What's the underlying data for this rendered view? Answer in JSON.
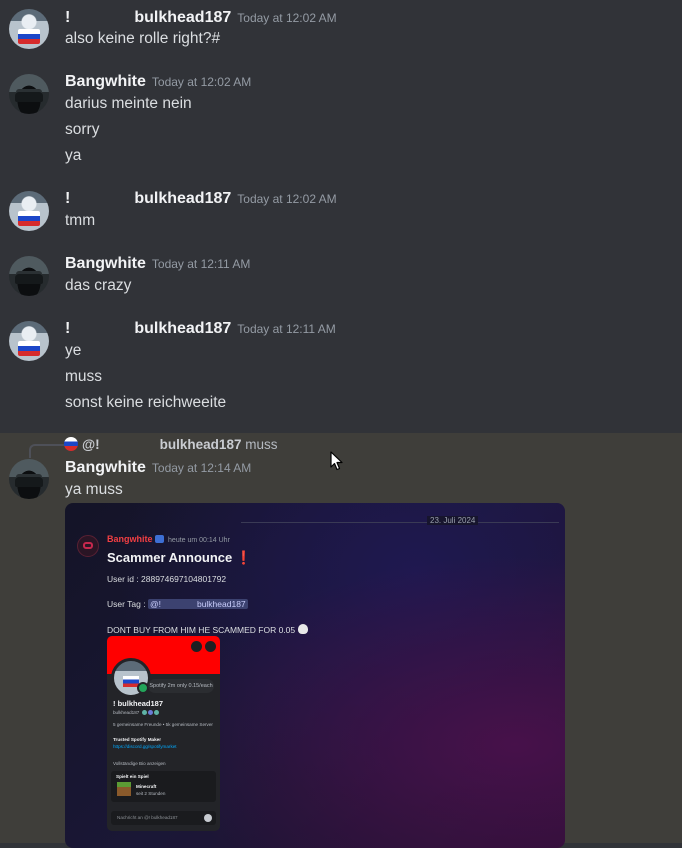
{
  "messages": [
    {
      "user": "!",
      "user2": "bulkhead187",
      "ts": "Today at 12:02 AM",
      "lines": [
        "also keine rolle right?#"
      ]
    },
    {
      "user": "Bangwhite",
      "ts": "Today at 12:02 AM",
      "lines": [
        "darius meinte nein",
        "sorry",
        "ya"
      ]
    },
    {
      "user": "!",
      "user2": "bulkhead187",
      "ts": "Today at 12:02 AM",
      "lines": [
        "tmm"
      ]
    },
    {
      "user": "Bangwhite",
      "ts": "Today at 12:11 AM",
      "lines": [
        "das crazy"
      ]
    },
    {
      "user": "!",
      "user2": "bulkhead187",
      "ts": "Today at 12:11 AM",
      "lines": [
        "ye",
        "muss",
        "sonst keine reichweeite"
      ]
    },
    {
      "user": "Bangwhite",
      "ts": "Today at 12:14 AM",
      "lines": [
        "ya muss"
      ],
      "reply": {
        "at": "@!",
        "name": "bulkhead187",
        "text": "muss"
      }
    }
  ],
  "embed": {
    "date": "23. Juli 2024",
    "author": "Bangwhite",
    "time": "heute um 00:14 Uhr",
    "title": "Scammer Announce",
    "title_emoji": "❗",
    "user_id": "User id : 288974697104801792",
    "user_tag_label": "User Tag :",
    "user_tag_at": "@!",
    "user_tag_name": "bulkhead187",
    "warning": "DONT BUY FROM HIM HE SCAMMED FOR  0.05",
    "card": {
      "status_bubble": "Spotify 2m only 0.15/each",
      "display_name": "! bulkhead187",
      "username": "bulkhead187",
      "mutual": "5 gemeinsame Freunde  •  5k gemeinsame Server",
      "about_title": "Trusted Spotify Maker",
      "about_link": "https://discord.gg/spotifymarket",
      "full_profile": "Vollständige Bio anzeigen",
      "activity_label": "Spielt ein Spiel",
      "game": "Minecraft",
      "game_time": "seit 2 Stunden",
      "message_placeholder": "Nachricht an @! bulkhead187"
    }
  }
}
